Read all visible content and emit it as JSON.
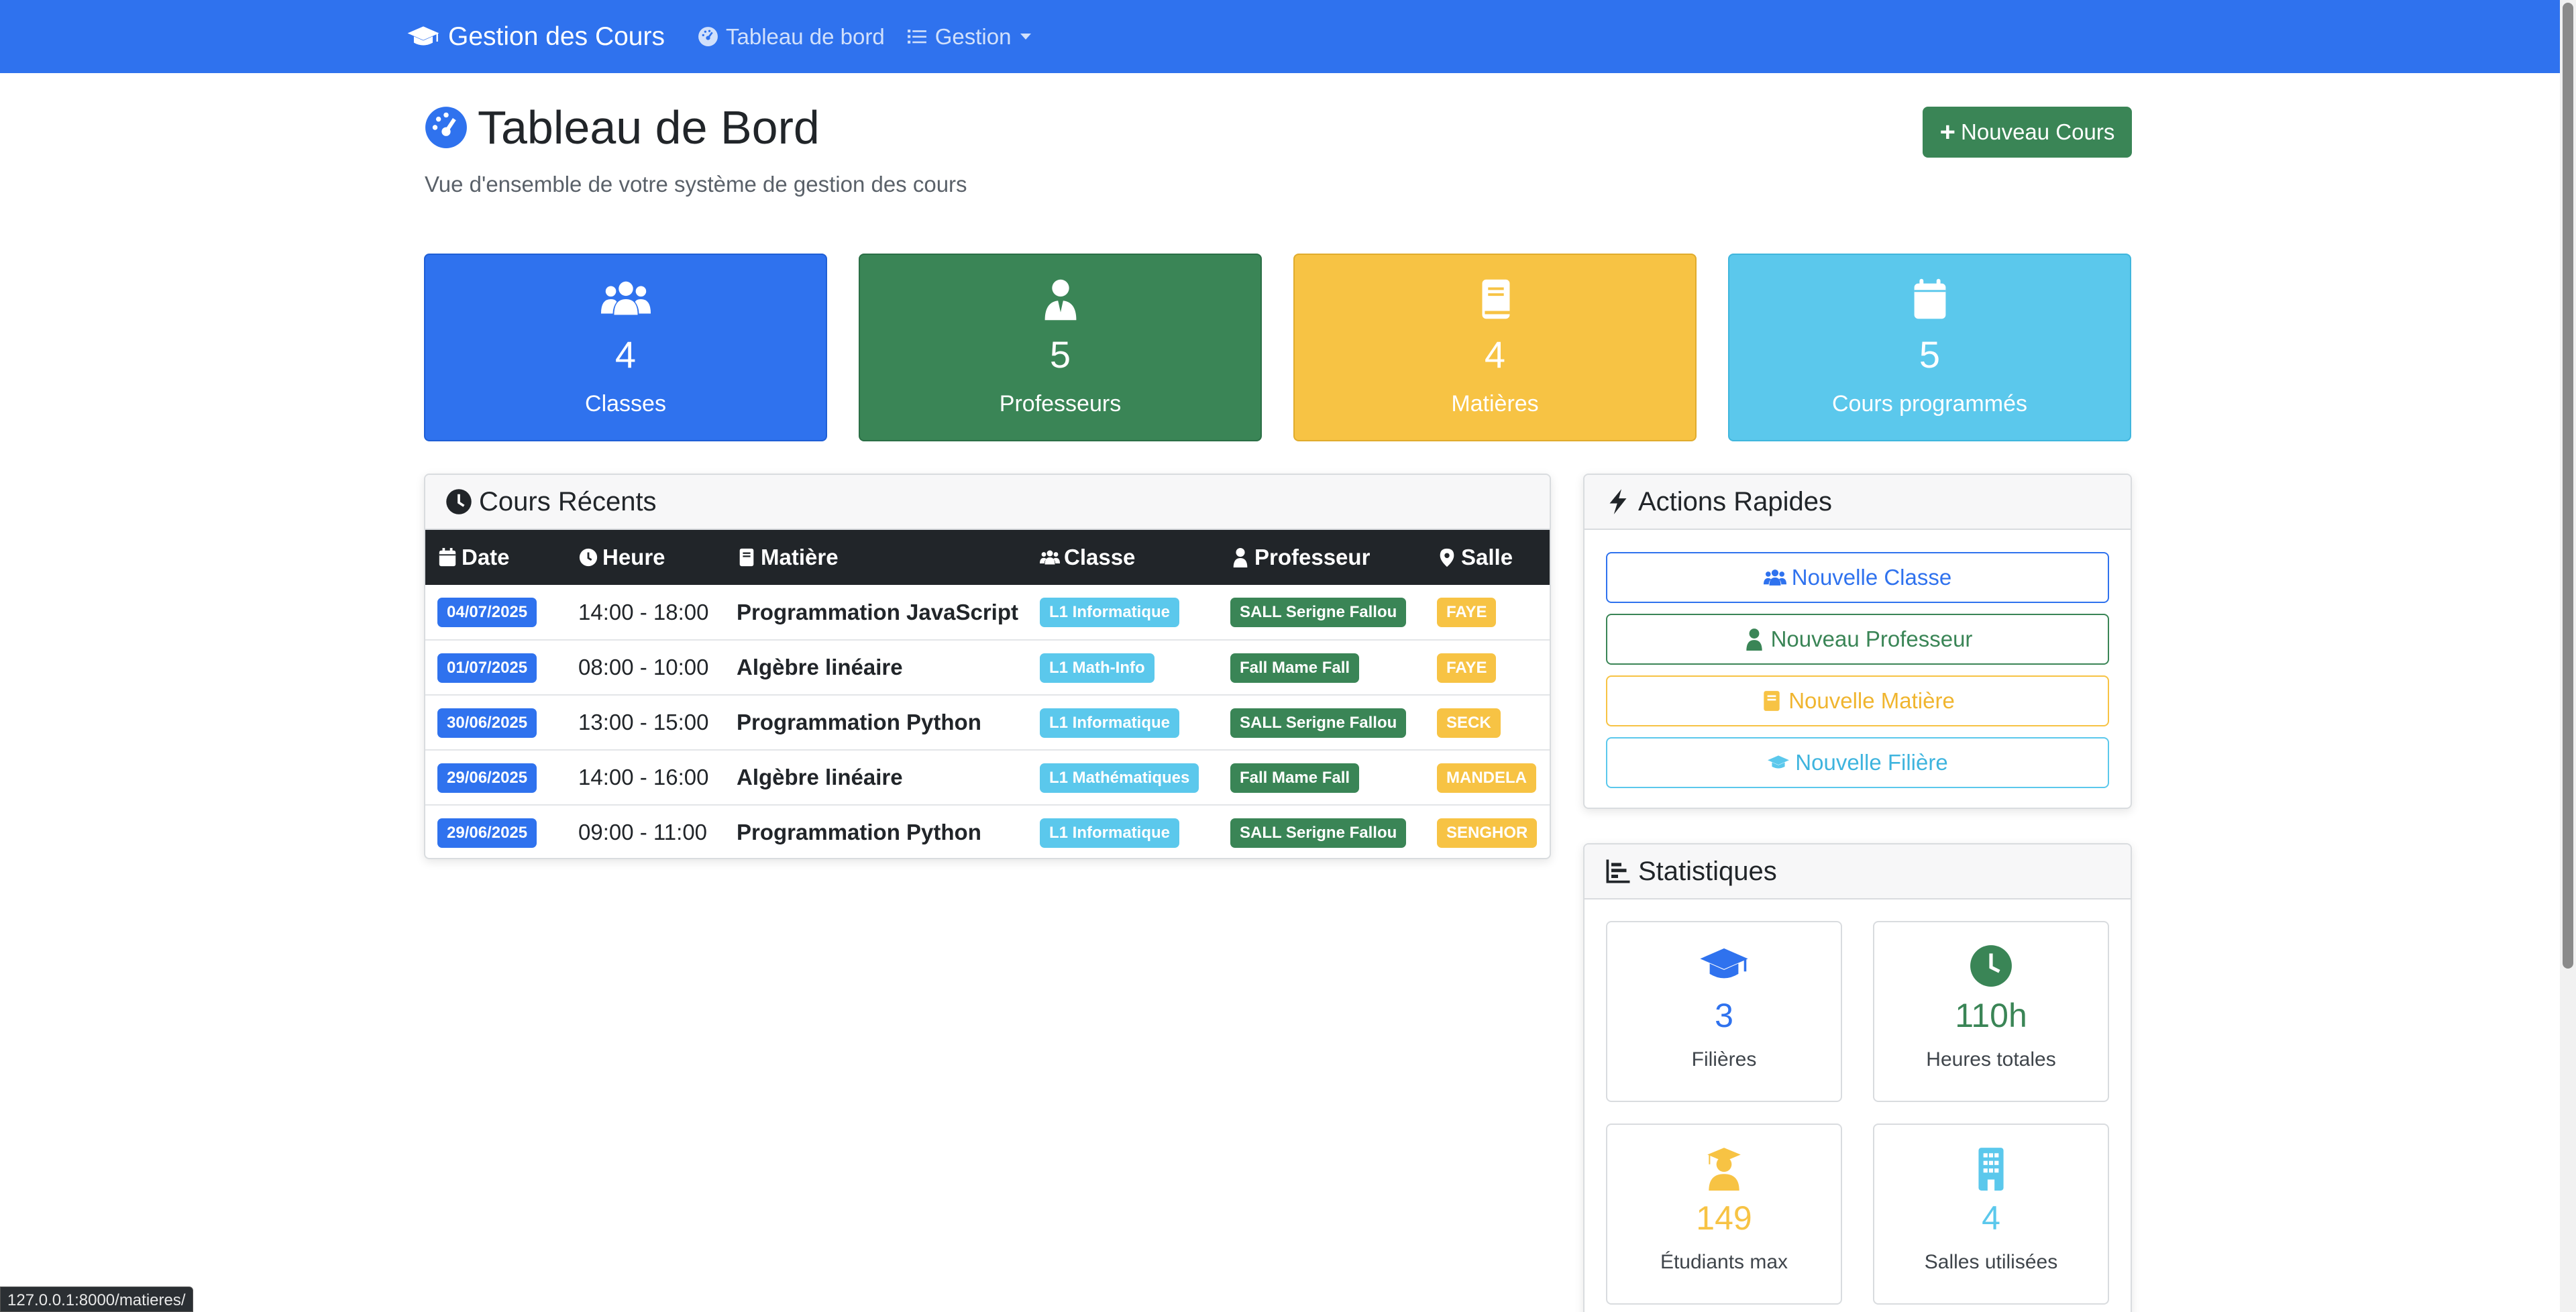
{
  "navbar": {
    "brand": "Gestion des Cours",
    "dashboard_link": "Tableau de bord",
    "manage_link": "Gestion"
  },
  "header": {
    "title": "Tableau de Bord",
    "subtitle": "Vue d'ensemble de votre système de gestion des cours",
    "new_course_button": "Nouveau Cours"
  },
  "stat_cards": [
    {
      "value": "4",
      "label": "Classes",
      "icon": "users-icon"
    },
    {
      "value": "5",
      "label": "Professeurs",
      "icon": "teacher-icon"
    },
    {
      "value": "4",
      "label": "Matières",
      "icon": "book-icon"
    },
    {
      "value": "5",
      "label": "Cours programmés",
      "icon": "calendar-icon"
    }
  ],
  "recent": {
    "title": "Cours Récents",
    "columns": [
      "Date",
      "Heure",
      "Matière",
      "Classe",
      "Professeur",
      "Salle"
    ],
    "rows": [
      {
        "date": "04/07/2025",
        "time": "14:00 - 18:00",
        "subject": "Programmation JavaScript",
        "class": "L1 Informatique",
        "professor": "SALL Serigne Fallou",
        "room": "FAYE"
      },
      {
        "date": "01/07/2025",
        "time": "08:00 - 10:00",
        "subject": "Algèbre linéaire",
        "class": "L1 Math-Info",
        "professor": "Fall Mame Fall",
        "room": "FAYE"
      },
      {
        "date": "30/06/2025",
        "time": "13:00 - 15:00",
        "subject": "Programmation Python",
        "class": "L1 Informatique",
        "professor": "SALL Serigne Fallou",
        "room": "SECK"
      },
      {
        "date": "29/06/2025",
        "time": "14:00 - 16:00",
        "subject": "Algèbre linéaire",
        "class": "L1 Mathématiques",
        "professor": "Fall Mame Fall",
        "room": "MANDELA"
      },
      {
        "date": "29/06/2025",
        "time": "09:00 - 11:00",
        "subject": "Programmation Python",
        "class": "L1 Informatique",
        "professor": "SALL Serigne Fallou",
        "room": "SENGHOR"
      }
    ]
  },
  "actions": {
    "title": "Actions Rapides",
    "new_class": "Nouvelle Classe",
    "new_professor": "Nouveau Professeur",
    "new_subject": "Nouvelle Matière",
    "new_track": "Nouvelle Filière"
  },
  "stats": {
    "title": "Statistiques",
    "items": [
      {
        "value": "3",
        "label": "Filières",
        "icon": "graduation-cap-icon"
      },
      {
        "value": "110h",
        "label": "Heures totales",
        "icon": "clock-icon"
      },
      {
        "value": "149",
        "label": "Étudiants max",
        "icon": "graduate-student-icon"
      },
      {
        "value": "4",
        "label": "Salles utilisées",
        "icon": "building-icon"
      }
    ]
  },
  "status_bar": {
    "url": "127.0.0.1:8000/matieres/"
  },
  "colors": {
    "primary": "#2f72ee",
    "success": "#3a8556",
    "warning": "#f7c344",
    "info": "#5bc8ec",
    "dark": "#212529"
  }
}
